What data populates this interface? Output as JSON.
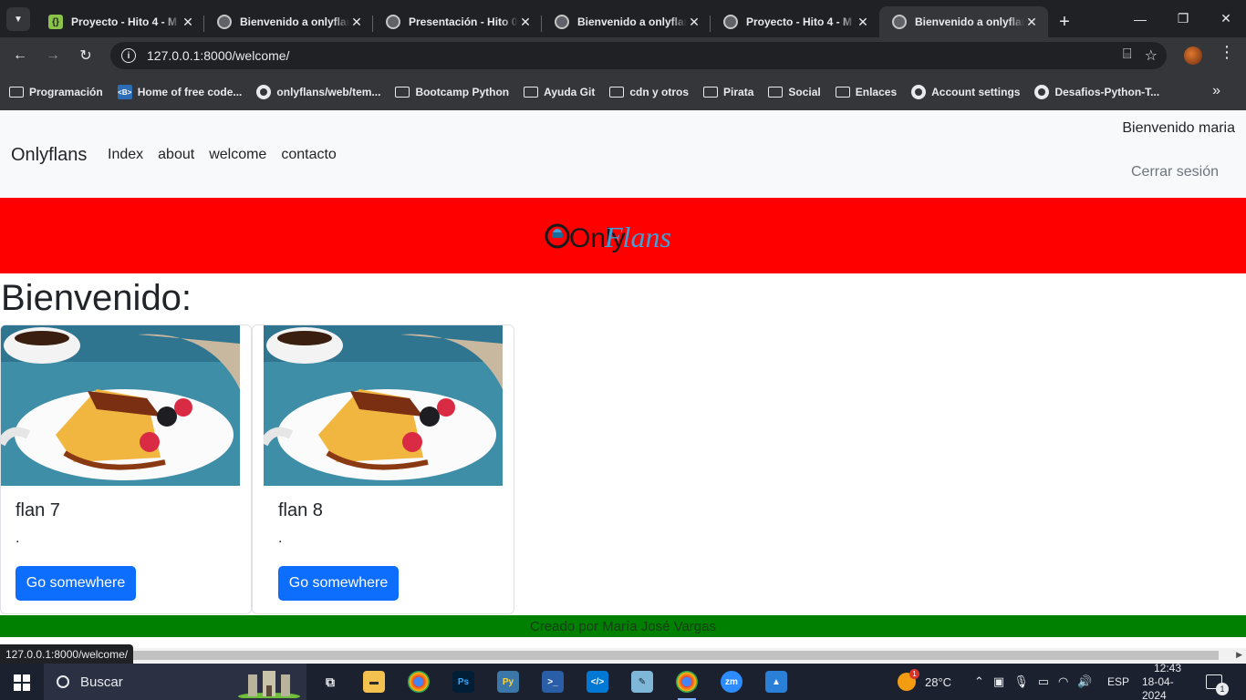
{
  "browser": {
    "tabs": [
      {
        "title": "Proyecto - Hito 4 - M",
        "icon": "sheets-icon",
        "active": false
      },
      {
        "title": "Bienvenido a onlyflans",
        "icon": "globe-icon",
        "active": false
      },
      {
        "title": "Presentación - Hito 0",
        "icon": "globe-icon",
        "active": false
      },
      {
        "title": "Bienvenido a onlyflans",
        "icon": "globe-icon",
        "active": false
      },
      {
        "title": "Proyecto - Hito 4 - M",
        "icon": "globe-icon",
        "active": false
      },
      {
        "title": "Bienvenido a onlyflans",
        "icon": "globe-icon",
        "active": true
      }
    ],
    "url": "127.0.0.1:8000/welcome/",
    "bookmarks": [
      {
        "label": "Programación",
        "icon": "folder-icon"
      },
      {
        "label": "Home of free code...",
        "icon": "freecodecamp-icon"
      },
      {
        "label": "onlyflans/web/tem...",
        "icon": "github-icon"
      },
      {
        "label": "Bootcamp Python",
        "icon": "folder-icon"
      },
      {
        "label": "Ayuda Git",
        "icon": "folder-icon"
      },
      {
        "label": "cdn y otros",
        "icon": "folder-icon"
      },
      {
        "label": "Pirata",
        "icon": "folder-icon"
      },
      {
        "label": "Social",
        "icon": "folder-icon"
      },
      {
        "label": "Enlaces",
        "icon": "folder-icon"
      },
      {
        "label": "Account settings",
        "icon": "github-icon"
      },
      {
        "label": "Desafios-Python-T...",
        "icon": "github-icon"
      }
    ],
    "status_url": "127.0.0.1:8000/welcome/"
  },
  "navbar": {
    "brand": "Onlyflans",
    "links": [
      "Index",
      "about",
      "welcome",
      "contacto"
    ],
    "greeting": "Bienvenido maria",
    "logout": "Cerrar sesión"
  },
  "banner": {
    "logo_text_a": "Only",
    "logo_text_b": "Flans",
    "color": "#ff0000"
  },
  "main": {
    "heading": "Bienvenido:",
    "cards": [
      {
        "title": "flan 7",
        "text": ".",
        "button": "Go somewhere"
      },
      {
        "title": "flan 8",
        "text": ".",
        "button": "Go somewhere"
      }
    ]
  },
  "footer": {
    "text": "Creado por María José Vargas",
    "color": "#008000"
  },
  "taskbar": {
    "search_label": "Buscar",
    "temperature": "28°C",
    "language": "ESP",
    "time": "12:43",
    "date": "18-04-2024",
    "notification_count": "1",
    "weather_badge": "1"
  }
}
